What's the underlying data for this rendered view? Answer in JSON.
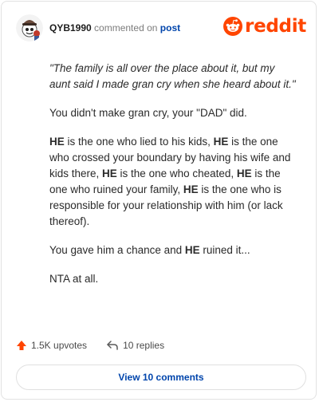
{
  "header": {
    "username": "QYB1990",
    "commented_on": "commented on",
    "post_link": "post",
    "brand": "reddit"
  },
  "comment": {
    "quote": "\"The family is all over the place about it, but my aunt said I made gran cry when she heard about it.\"",
    "para1": "You didn't make gran cry, your \"DAD\" did.",
    "para2": [
      {
        "text": "HE",
        "bold": true
      },
      {
        "text": " is the one who lied to his kids, ",
        "bold": false
      },
      {
        "text": "HE",
        "bold": true
      },
      {
        "text": " is the one who crossed your boundary by having his wife and kids there, ",
        "bold": false
      },
      {
        "text": "HE",
        "bold": true
      },
      {
        "text": " is the one who cheated, ",
        "bold": false
      },
      {
        "text": "HE",
        "bold": true
      },
      {
        "text": " is the one who ruined your family, ",
        "bold": false
      },
      {
        "text": "HE",
        "bold": true
      },
      {
        "text": " is the one who is responsible for your relationship with him (or lack thereof).",
        "bold": false
      }
    ],
    "para3_pre": "You gave him a chance and ",
    "para3_bold": "HE",
    "para3_post": " ruined it...",
    "para4": "NTA at all."
  },
  "actions": {
    "upvotes": "1.5K upvotes",
    "replies": "10 replies"
  },
  "view_comments": "View 10 comments",
  "colors": {
    "brand": "#ff4500",
    "link": "#0045ac",
    "upvote": "#ff4500"
  },
  "icons": [
    "avatar",
    "reddit-logo-icon",
    "upvote-arrow-icon",
    "reply-arrow-icon"
  ]
}
